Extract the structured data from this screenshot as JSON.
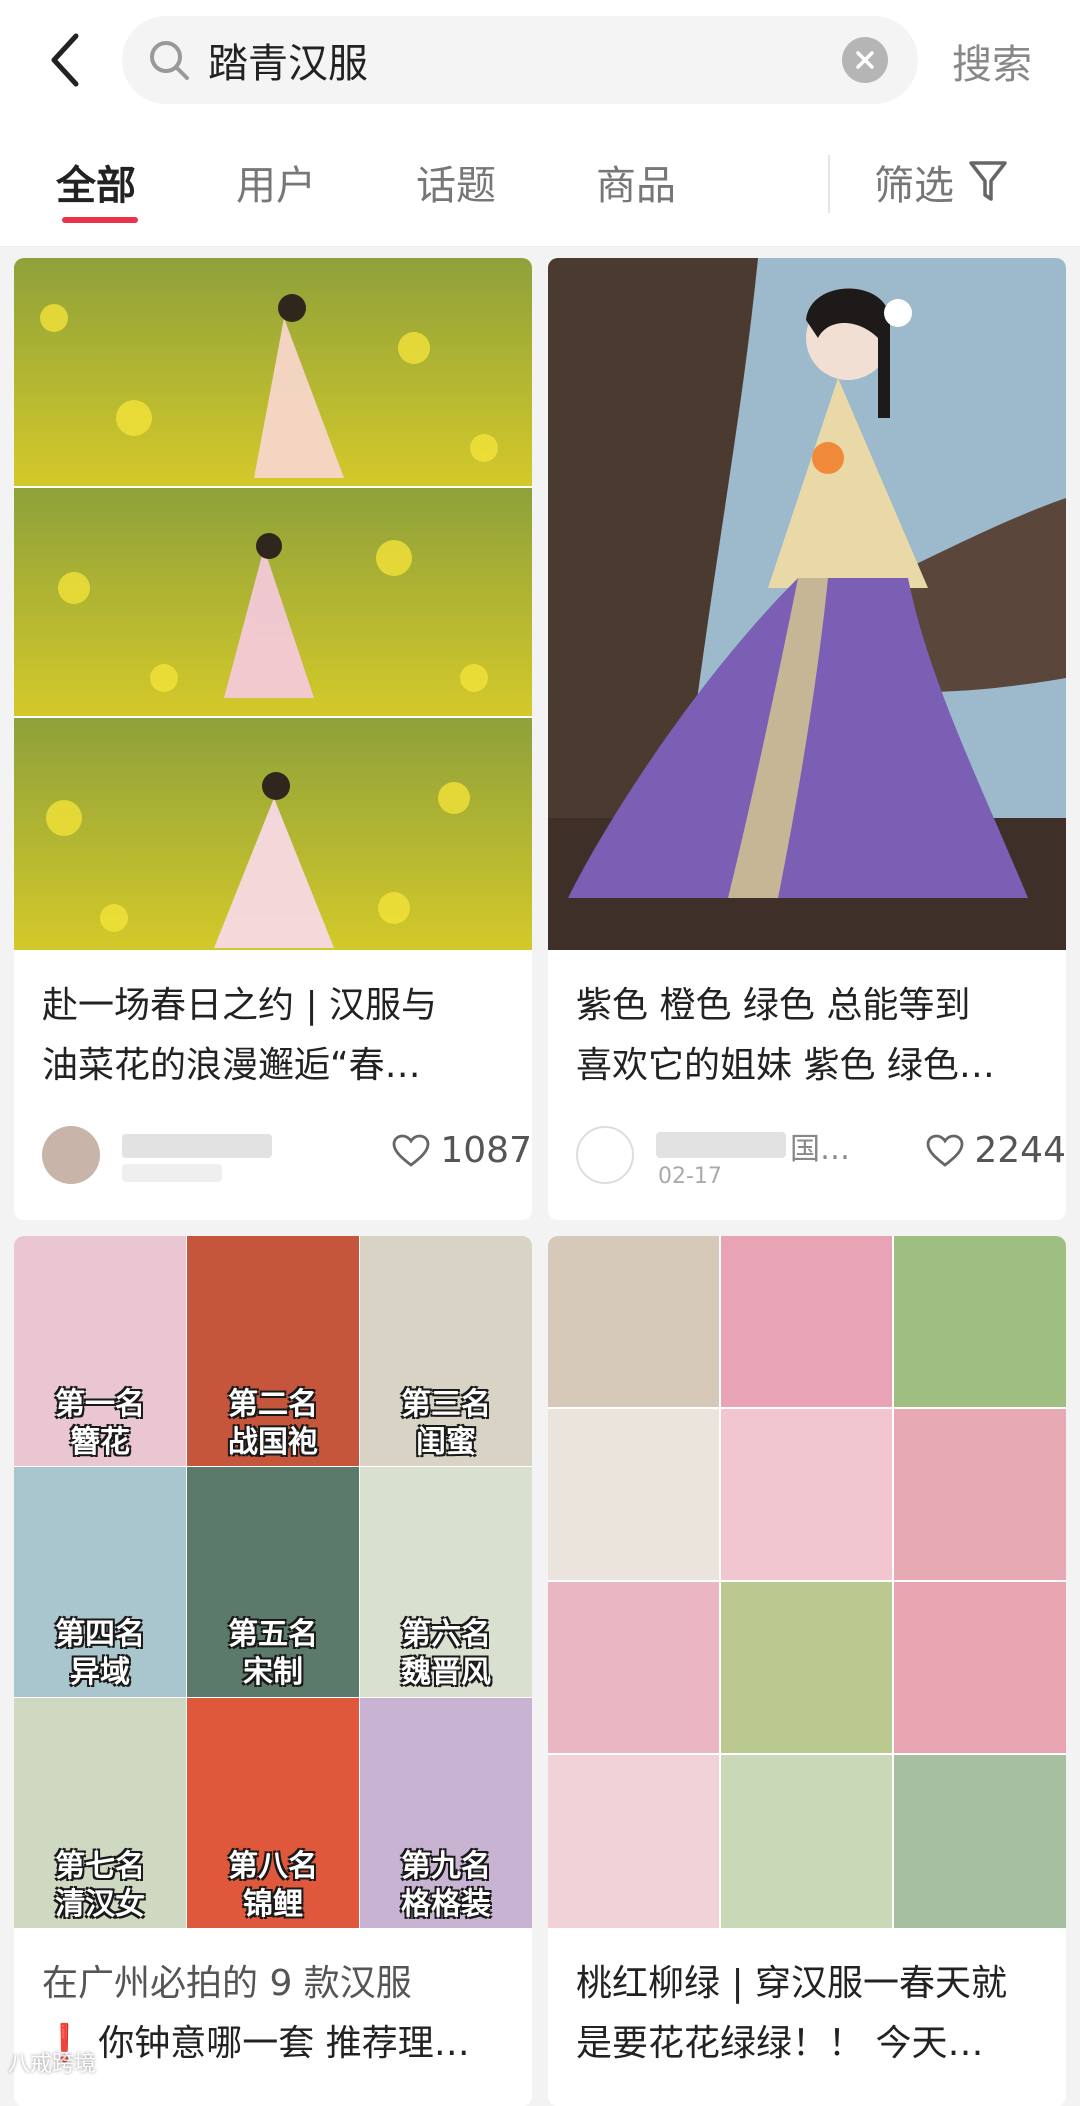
{
  "search": {
    "query": "踏青汉服",
    "submit_label": "搜索"
  },
  "tabs": [
    {
      "label": "全部",
      "active": true
    },
    {
      "label": "用户",
      "active": false
    },
    {
      "label": "话题",
      "active": false
    },
    {
      "label": "商品",
      "active": false
    }
  ],
  "filter_label": "筛选",
  "colors": {
    "accent": "#e8334a",
    "background": "#f3f3f3"
  },
  "icons": [
    "back-arrow-icon",
    "search-icon",
    "clear-icon",
    "filter-funnel-icon",
    "heart-icon"
  ],
  "posts": [
    {
      "title_line1": "赴一场春日之约 | 汉服与",
      "title_line2": "油菜花的浪漫邂逅“春…",
      "likes": "1087"
    },
    {
      "title_line1": "紫色 橙色 绿色 总能等到",
      "title_line2": "喜欢它的姐妹 紫色 绿色…",
      "likes": "2244",
      "author_fragment": "国…",
      "date_fragment": "02-17"
    },
    {
      "title_line1": "在广州必拍的 9 款汉服",
      "title_line2": "❗ 你钟意哪一套 推荐理…",
      "ranks": [
        [
          "第一名",
          "簪花"
        ],
        [
          "第二名",
          "战国袍"
        ],
        [
          "第三名",
          "闺蜜"
        ],
        [
          "第四名",
          "异域"
        ],
        [
          "第五名",
          "宋制"
        ],
        [
          "第六名",
          "魏晋风"
        ],
        [
          "第七名",
          "清汉女"
        ],
        [
          "第八名",
          "锦鲤"
        ],
        [
          "第九名",
          "格格装"
        ]
      ]
    },
    {
      "title_line1": "桃红柳绿 | 穿汉服一春天就",
      "title_line2": "是要花花绿绿！！ 今天…"
    }
  ],
  "watermark": "八戒跨境"
}
